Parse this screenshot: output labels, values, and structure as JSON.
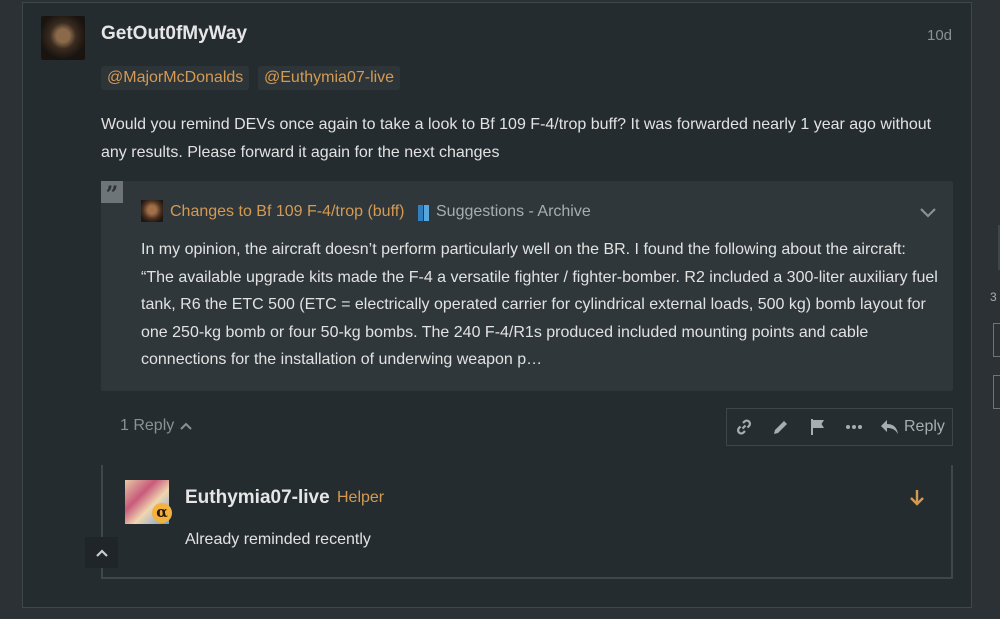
{
  "post": {
    "username": "GetOut0fMyWay",
    "date": "10d",
    "mentions": [
      "@MajorMcDonalds",
      "@Euthymia07-live"
    ],
    "text": "Would you remind DEVs once again to take a look to Bf 109 F-4/trop buff? It was forwarded nearly 1 year ago without any results. Please forward it again for the next changes"
  },
  "quote": {
    "mark": "”",
    "title": "Changes to Bf 109 F-4/trop (buff)",
    "category": "Suggestions - Archive",
    "category_colors": [
      "#2f7fc1",
      "#58a6de"
    ],
    "body": "In my opinion, the aircraft doesn’t perform particularly well on the BR. I found the following about the aircraft: “The available upgrade kits made the F-4 a versatile fighter / fighter-bomber. R2 included a 300-liter auxiliary fuel tank, R6 the ETC 500 (ETC = electrically operated carrier for cylindrical external loads, 500 kg) bomb layout for one 250-kg bomb or four 50-kg bombs. The 240 F-4/R1s produced included mounting points and cable connections for the installation of underwing weapon p…"
  },
  "replies_toggle": {
    "label": "1 Reply"
  },
  "actions": {
    "icons": [
      "link-icon",
      "edit-icon",
      "flag-icon",
      "more-icon"
    ],
    "reply_label": "Reply"
  },
  "reply": {
    "username": "Euthymia07-live",
    "user_title": "Helper",
    "badge": "α",
    "text": "Already reminded recently"
  },
  "edge": {
    "number": "3"
  },
  "colors": {
    "accent": "#d49a54",
    "muted": "#8b9092",
    "text": "#e2e2e2",
    "background": "#252c30"
  }
}
